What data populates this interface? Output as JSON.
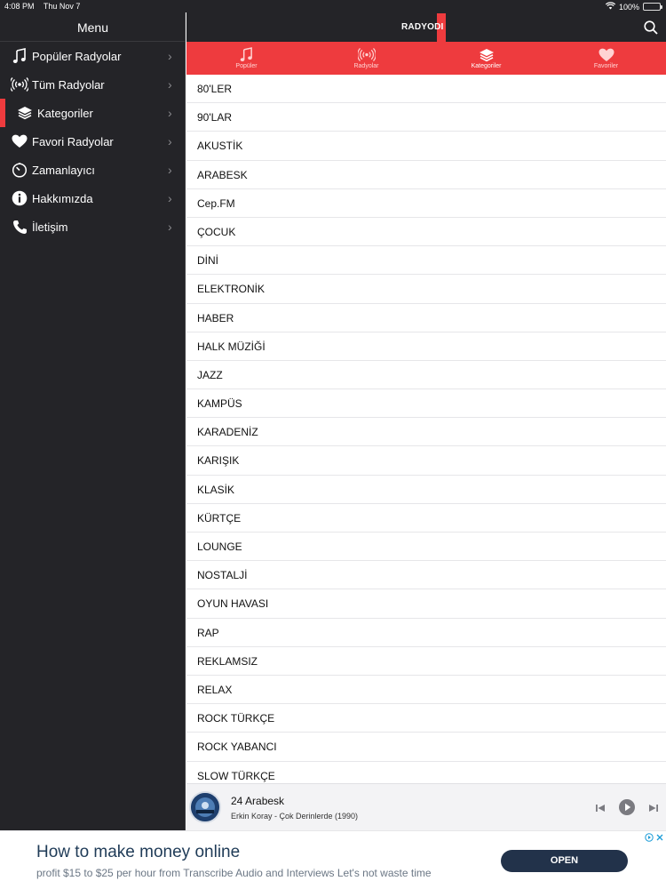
{
  "status_bar": {
    "time": "4:08 PM",
    "date": "Thu Nov 7",
    "battery": "100%"
  },
  "sidebar": {
    "title": "Menu",
    "items": [
      {
        "label": "Popüler Radyolar",
        "icon": "music-note-icon"
      },
      {
        "label": "Tüm Radyolar",
        "icon": "broadcast-icon"
      },
      {
        "label": "Kategoriler",
        "icon": "layers-icon",
        "active": true
      },
      {
        "label": "Favori Radyolar",
        "icon": "heart-icon"
      },
      {
        "label": "Zamanlayıcı",
        "icon": "timer-icon"
      },
      {
        "label": "Hakkımızda",
        "icon": "info-icon"
      },
      {
        "label": "İletişim",
        "icon": "phone-icon"
      }
    ]
  },
  "header": {
    "brand": "RADYODI"
  },
  "tabs": [
    {
      "label": "Popüler",
      "icon": "music-note-icon"
    },
    {
      "label": "Radyolar",
      "icon": "broadcast-icon"
    },
    {
      "label": "Kategoriler",
      "icon": "layers-icon",
      "active": true
    },
    {
      "label": "Favoriler",
      "icon": "heart-icon"
    }
  ],
  "categories": [
    "80'LER",
    "90'LAR",
    "AKUSTİK",
    "ARABESK",
    "Cep.FM",
    "ÇOCUK",
    "DİNİ",
    "ELEKTRONİK",
    "HABER",
    "HALK MÜZİĞİ",
    "JAZZ",
    "KAMPÜS",
    "KARADENİZ",
    "KARIŞIK",
    "KLASİK",
    "KÜRTÇE",
    "LOUNGE",
    "NOSTALJİ",
    "OYUN HAVASI",
    "RAP",
    "REKLAMSIZ",
    "RELAX",
    "ROCK TÜRKÇE",
    "ROCK YABANCI",
    "SLOW TÜRKÇE"
  ],
  "player": {
    "station": "24 Arabesk",
    "track": "Erkin Koray - Çok Derinlerde (1990)"
  },
  "ad": {
    "title": "How to make money online",
    "text": "profit $15 to $25 per hour from Transcribe Audio and Interviews Let's not waste time",
    "button": "OPEN"
  },
  "colors": {
    "accent": "#ee3b3e",
    "sidebar_bg": "#242428",
    "ad_button": "#22324a"
  }
}
